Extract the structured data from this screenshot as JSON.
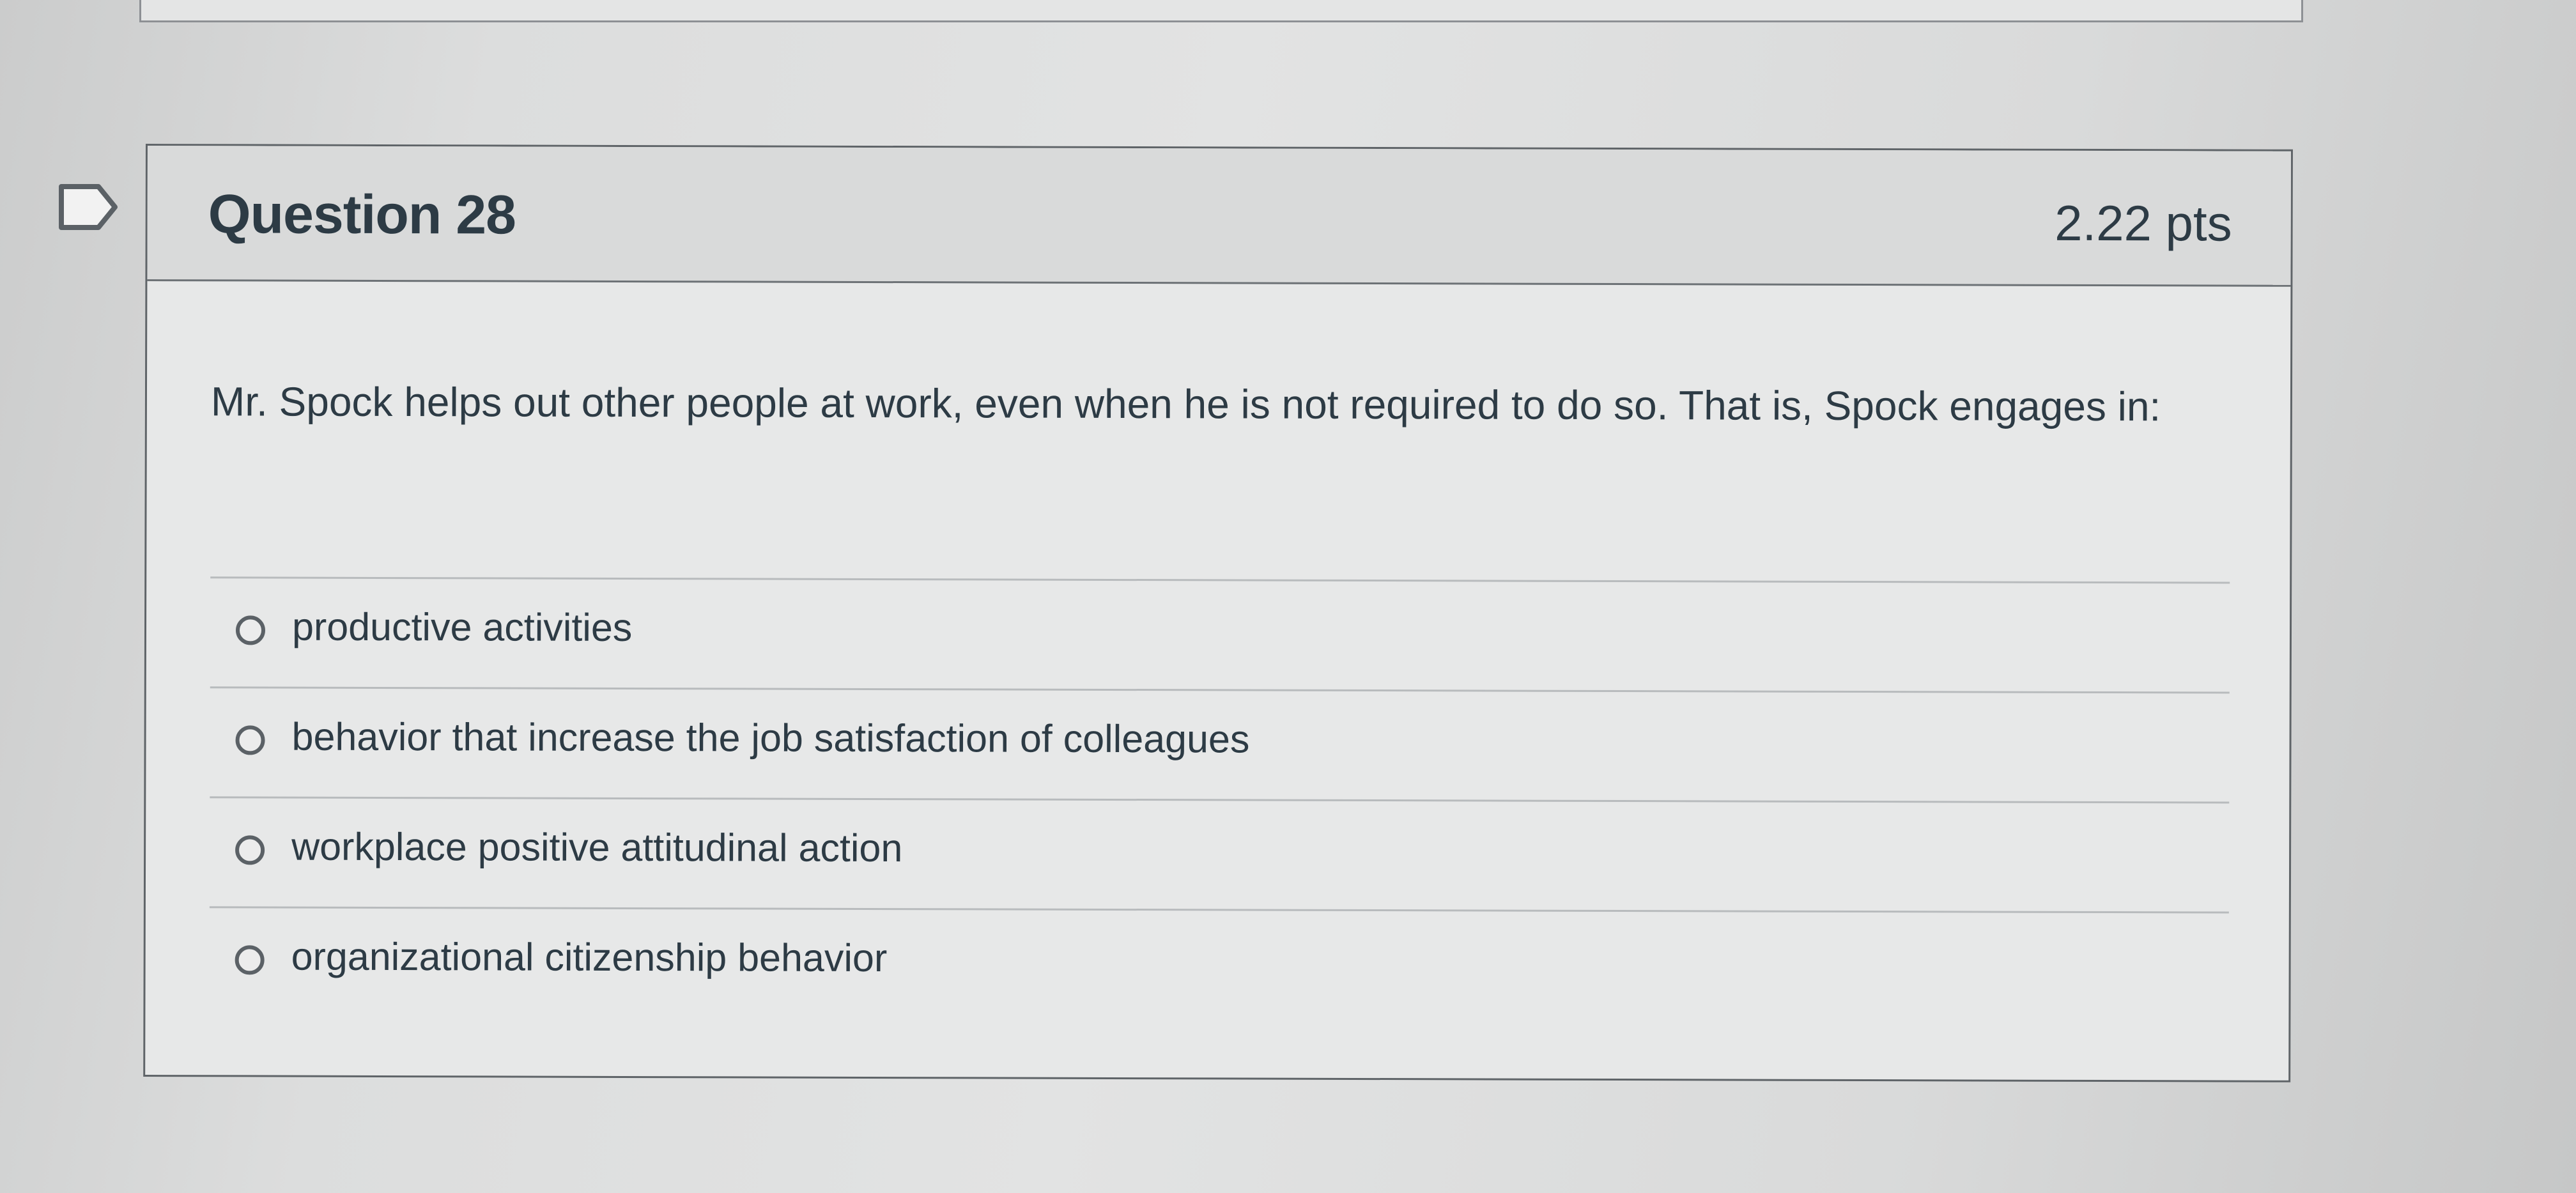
{
  "question": {
    "title": "Question 28",
    "points": "2.22 pts",
    "text": "Mr. Spock helps out other people at work, even when he is not required to do so. That is, Spock engages in:",
    "flag_icon": "bookmark-flag-icon"
  },
  "answers": [
    {
      "label": "productive activities",
      "selected": false
    },
    {
      "label": "behavior that increase the job satisfaction of colleagues",
      "selected": false
    },
    {
      "label": "workplace positive attitudinal action",
      "selected": false
    },
    {
      "label": "organizational citizenship behavior",
      "selected": false
    }
  ]
}
